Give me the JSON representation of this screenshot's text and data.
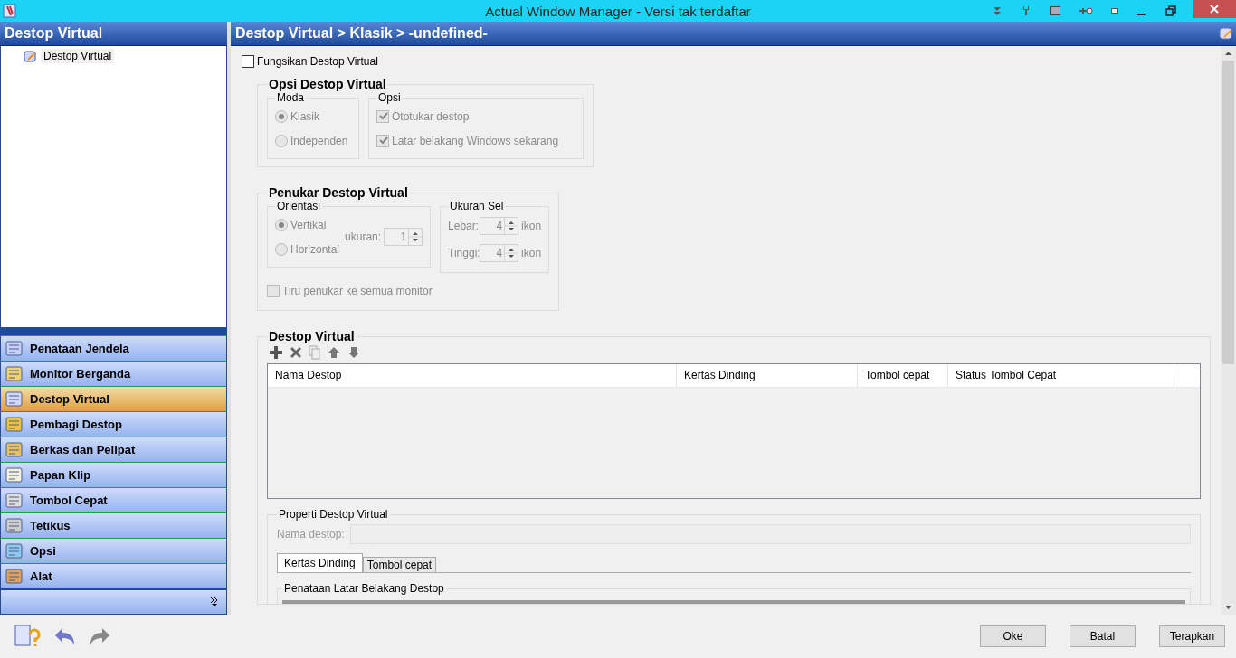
{
  "window": {
    "title": "Actual Window Manager - Versi tak terdaftar"
  },
  "sidebar": {
    "title": "Destop Virtual",
    "tree": [
      {
        "label": "Destop Virtual",
        "selected": true
      }
    ],
    "nav": [
      {
        "label": "Penataan Jendela",
        "selected": false
      },
      {
        "label": "Monitor Berganda",
        "selected": false
      },
      {
        "label": "Destop Virtual",
        "selected": true
      },
      {
        "label": "Pembagi Destop",
        "selected": false
      },
      {
        "label": "Berkas dan Pelipat",
        "selected": false
      },
      {
        "label": "Papan Klip",
        "selected": false
      },
      {
        "label": "Tombol Cepat",
        "selected": false
      },
      {
        "label": "Tetikus",
        "selected": false
      },
      {
        "label": "Opsi",
        "selected": false
      },
      {
        "label": "Alat",
        "selected": false
      }
    ]
  },
  "main": {
    "breadcrumb": "Destop Virtual > Klasik > -undefined-",
    "enable": {
      "label": "Fungsikan Destop Virtual",
      "checked": false
    },
    "options_group": {
      "title": "Opsi Destop Virtual",
      "disabled": true,
      "mode": {
        "title": "Moda",
        "options": [
          {
            "label": "Klasik",
            "selected": true
          },
          {
            "label": "Independen",
            "selected": false
          }
        ]
      },
      "opsi": {
        "title": "Opsi",
        "items": [
          {
            "label": "Ototukar destop",
            "checked": true
          },
          {
            "label": "Latar belakang Windows sekarang",
            "checked": true
          }
        ]
      }
    },
    "switcher": {
      "title": "Penukar Destop Virtual",
      "disabled": true,
      "orientation": {
        "title": "Orientasi",
        "options": [
          {
            "label": "Vertikal",
            "selected": true
          },
          {
            "label": "Horizontal",
            "selected": false
          }
        ],
        "size_label": "ukuran:",
        "size_value": "1"
      },
      "cell_size": {
        "title": "Ukuran Sel",
        "rows": [
          {
            "label": "Lebar:",
            "value": "4",
            "unit": "ikon"
          },
          {
            "label": "Tinggi:",
            "value": "4",
            "unit": "ikon"
          }
        ]
      },
      "mirror": {
        "label": "Tiru penukar ke semua monitor",
        "checked": false
      }
    },
    "desktops": {
      "title": "Destop Virtual",
      "columns": [
        "Nama Destop",
        "Kertas Dinding",
        "Tombol cepat",
        "Status Tombol Cepat"
      ],
      "properties": {
        "title": "Properti Destop Virtual",
        "name_label": "Nama destop:",
        "tabs": [
          {
            "label": "Kertas Dinding",
            "selected": true
          },
          {
            "label": "Tombol cepat",
            "selected": false
          }
        ],
        "section": "Penataan Latar Belakang Destop"
      }
    }
  },
  "buttons": [
    "Oke",
    "Batal",
    "Terapkan"
  ]
}
